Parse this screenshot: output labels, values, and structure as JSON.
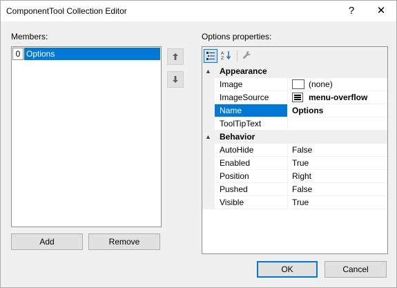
{
  "window": {
    "title": "ComponentTool Collection Editor",
    "help_glyph": "?",
    "close_glyph": "✕"
  },
  "members": {
    "label": "Members:",
    "items": [
      {
        "index": "0",
        "text": "Options"
      }
    ],
    "move_up_icon": "arrow-up",
    "move_down_icon": "arrow-down"
  },
  "buttons": {
    "add": "Add",
    "remove": "Remove",
    "ok": "OK",
    "cancel": "Cancel"
  },
  "properties": {
    "label": "Options properties:",
    "toolbar": {
      "categorized_icon": "categorized-icon",
      "alphabetical_icon": "alphabetical-icon",
      "property_pages_icon": "wrench-icon"
    },
    "categories": [
      {
        "name": "Appearance",
        "rows": [
          {
            "name": "Image",
            "value": "(none)"
          },
          {
            "name": "ImageSource",
            "value": "menu-overflow"
          },
          {
            "name": "Name",
            "value": "Options"
          },
          {
            "name": "ToolTipText",
            "value": ""
          }
        ]
      },
      {
        "name": "Behavior",
        "rows": [
          {
            "name": "AutoHide",
            "value": "False"
          },
          {
            "name": "Enabled",
            "value": "True"
          },
          {
            "name": "Position",
            "value": "Right"
          },
          {
            "name": "Pushed",
            "value": "False"
          },
          {
            "name": "Visible",
            "value": "True"
          }
        ]
      }
    ]
  },
  "colors": {
    "selection": "#0078d7",
    "dialog_bg": "#f0f0f0"
  }
}
